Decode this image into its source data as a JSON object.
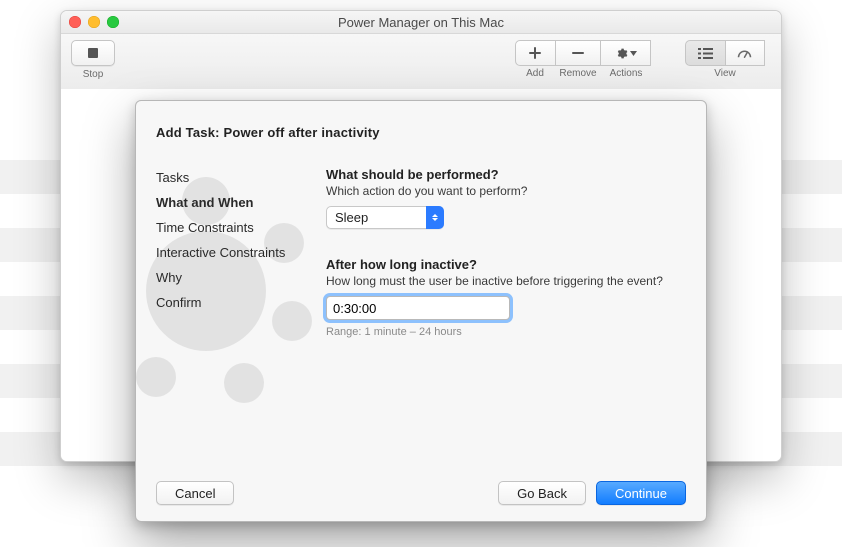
{
  "window": {
    "title": "Power Manager on This Mac"
  },
  "toolbar": {
    "stop": "Stop",
    "add": "Add",
    "remove": "Remove",
    "actions": "Actions",
    "view": "View"
  },
  "sheet": {
    "title": "Add Task: Power off after inactivity",
    "nav": {
      "tasks": "Tasks",
      "what_when": "What and When",
      "time_constraints": "Time Constraints",
      "interactive_constraints": "Interactive Constraints",
      "why": "Why",
      "confirm": "Confirm"
    },
    "section1": {
      "heading": "What should be performed?",
      "hint": "Which action do you want to perform?",
      "action_value": "Sleep"
    },
    "section2": {
      "heading": "After how long inactive?",
      "hint": "How long must the user be inactive before triggering the event?",
      "duration_value": "0:30:00",
      "range": "Range: 1 minute – 24 hours"
    },
    "buttons": {
      "cancel": "Cancel",
      "go_back": "Go Back",
      "continue": "Continue"
    }
  }
}
